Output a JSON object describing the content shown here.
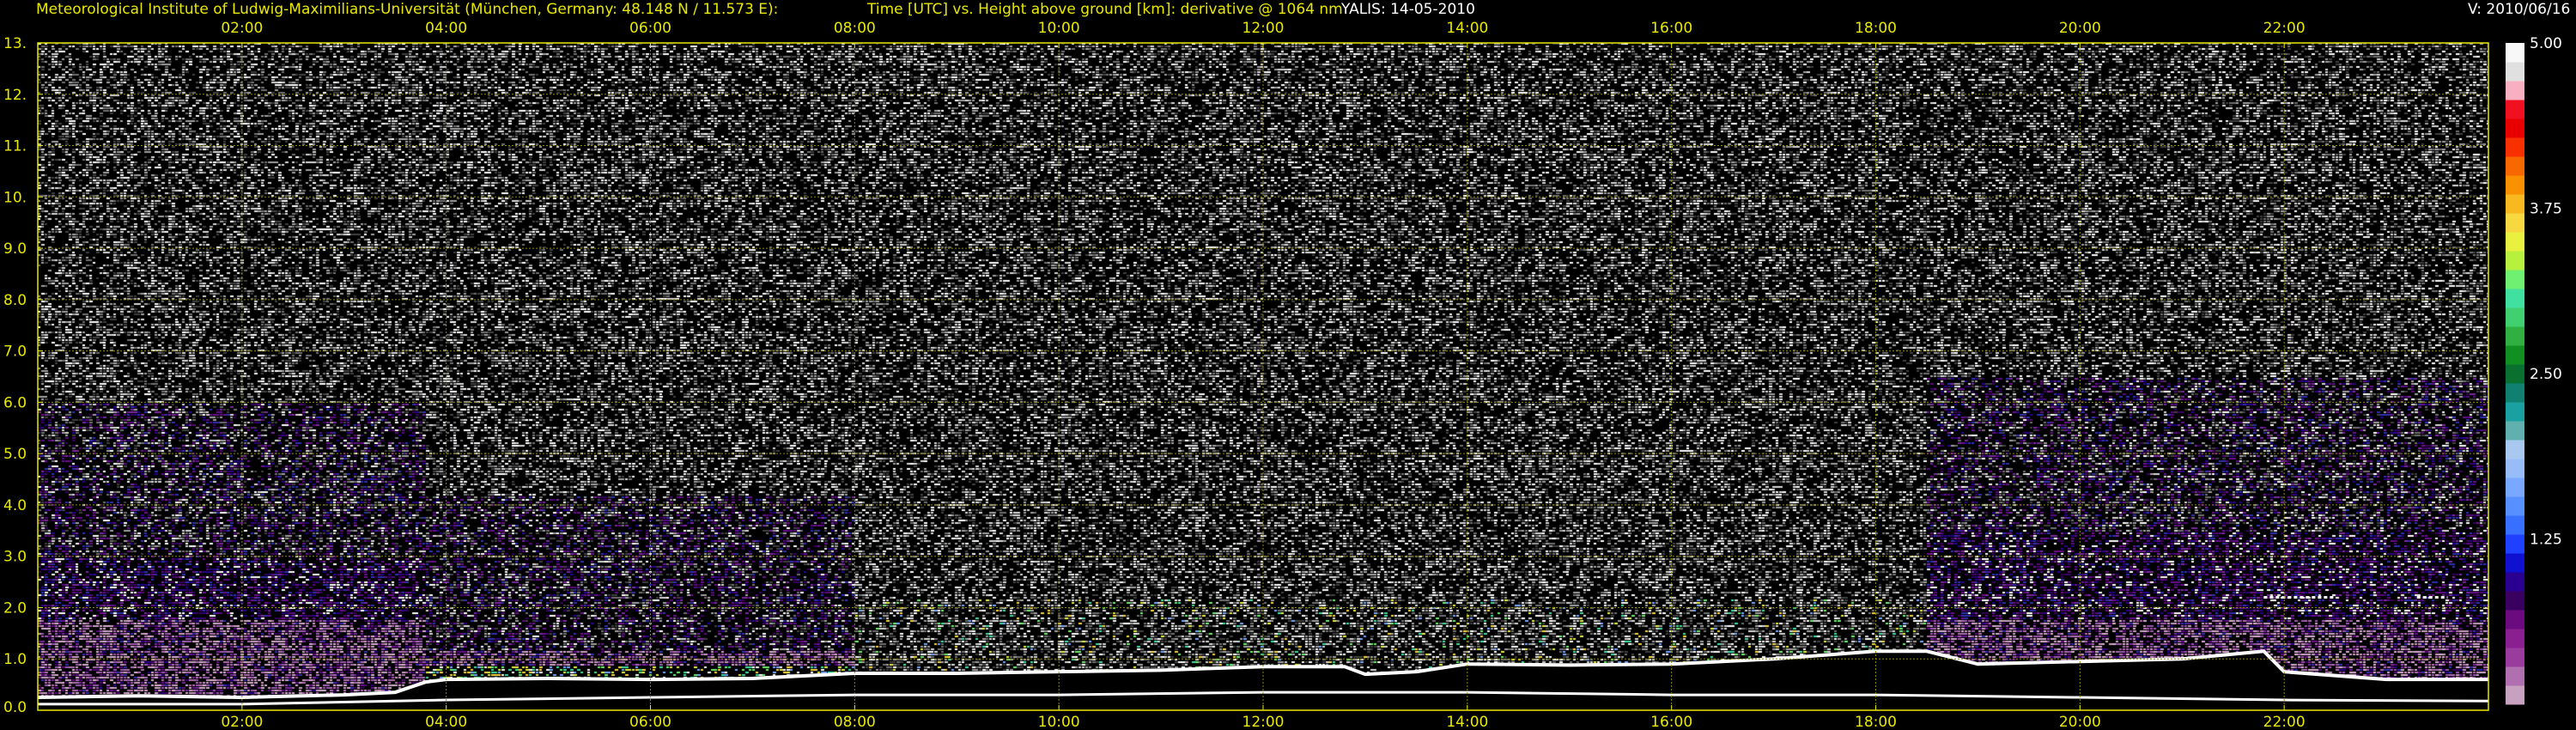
{
  "header": {
    "institute": "Meteorological Institute of Ludwig-Maximilians-Universität (München, Germany: 48.148 N / 11.573 E):",
    "description": "Time [UTC] vs. Height above ground [km]: derivative @ 1064 nm",
    "instrument_date": "YALIS: 14-05-2010",
    "version": "V: 2010/06/16"
  },
  "colors": {
    "axis_text": "#e8e800",
    "grid": "#8a8a00",
    "frame": "#e8e800",
    "background": "#000000"
  },
  "chart_data": {
    "type": "heatmap",
    "title": "Time [UTC] vs. Height above ground [km]: derivative @ 1064 nm",
    "xlabel": "Time [UTC]",
    "ylabel": "Height above ground [km]",
    "xlim": [
      0,
      24
    ],
    "ylim": [
      0,
      13
    ],
    "x_ticks": [
      {
        "hour": 2,
        "label": "02:00"
      },
      {
        "hour": 4,
        "label": "04:00"
      },
      {
        "hour": 6,
        "label": "06:00"
      },
      {
        "hour": 8,
        "label": "08:00"
      },
      {
        "hour": 10,
        "label": "10:00"
      },
      {
        "hour": 12,
        "label": "12:00"
      },
      {
        "hour": 14,
        "label": "14:00"
      },
      {
        "hour": 16,
        "label": "16:00"
      },
      {
        "hour": 18,
        "label": "18:00"
      },
      {
        "hour": 20,
        "label": "20:00"
      },
      {
        "hour": 22,
        "label": "22:00"
      }
    ],
    "y_ticks": [
      {
        "km": 0,
        "label": "0.0"
      },
      {
        "km": 1,
        "label": "1.0"
      },
      {
        "km": 2,
        "label": "2.0"
      },
      {
        "km": 3,
        "label": "3.0"
      },
      {
        "km": 4,
        "label": "4.0"
      },
      {
        "km": 5,
        "label": "5.0"
      },
      {
        "km": 6,
        "label": "6.0"
      },
      {
        "km": 7,
        "label": "7.0"
      },
      {
        "km": 8,
        "label": "8.0"
      },
      {
        "km": 9,
        "label": "9.0"
      },
      {
        "km": 10,
        "label": "10."
      },
      {
        "km": 11,
        "label": "11."
      },
      {
        "km": 12,
        "label": "12."
      },
      {
        "km": 13,
        "label": "13."
      }
    ],
    "grid": true,
    "colorbar": {
      "min": 0,
      "max": 5,
      "ticks": [
        {
          "value": 5.0,
          "label": "5.00"
        },
        {
          "value": 3.75,
          "label": "3.75"
        },
        {
          "value": 2.5,
          "label": "2.50"
        },
        {
          "value": 1.25,
          "label": "1.25"
        }
      ],
      "colors": [
        "#c8a0c0",
        "#b070b0",
        "#9a3c9e",
        "#8a2090",
        "#6a0c80",
        "#3a0060",
        "#2a0090",
        "#1010d0",
        "#2040ff",
        "#3870ff",
        "#5890ff",
        "#78a8ff",
        "#98bcf8",
        "#a8c8f0",
        "#60b0b0",
        "#1aa0a0",
        "#108070",
        "#0a7030",
        "#109020",
        "#30b040",
        "#40d070",
        "#40e0a0",
        "#70f070",
        "#b8f040",
        "#e8f040",
        "#f8d840",
        "#f8b820",
        "#f89000",
        "#f86800",
        "#f83000",
        "#e80000",
        "#f01020",
        "#f8b0c0",
        "#e0e0e0",
        "#f8f8f8"
      ]
    },
    "boundary_layer_top_km": [
      [
        0.0,
        0.25
      ],
      [
        1.0,
        0.28
      ],
      [
        2.0,
        0.25
      ],
      [
        3.0,
        0.3
      ],
      [
        3.5,
        0.35
      ],
      [
        3.8,
        0.55
      ],
      [
        4.0,
        0.6
      ],
      [
        5.0,
        0.62
      ],
      [
        6.0,
        0.6
      ],
      [
        7.0,
        0.62
      ],
      [
        8.0,
        0.72
      ],
      [
        9.0,
        0.72
      ],
      [
        10.0,
        0.75
      ],
      [
        11.0,
        0.78
      ],
      [
        12.0,
        0.85
      ],
      [
        12.8,
        0.85
      ],
      [
        13.0,
        0.7
      ],
      [
        13.5,
        0.75
      ],
      [
        14.0,
        0.9
      ],
      [
        15.0,
        0.88
      ],
      [
        16.0,
        0.9
      ],
      [
        17.0,
        1.0
      ],
      [
        18.0,
        1.15
      ],
      [
        18.5,
        1.15
      ],
      [
        19.0,
        0.9
      ],
      [
        20.0,
        0.95
      ],
      [
        21.0,
        1.0
      ],
      [
        21.8,
        1.15
      ],
      [
        22.0,
        0.75
      ],
      [
        23.0,
        0.6
      ],
      [
        24.0,
        0.6
      ]
    ],
    "surface_layer_km": [
      [
        0.0,
        0.12
      ],
      [
        2.0,
        0.12
      ],
      [
        4.0,
        0.2
      ],
      [
        6.0,
        0.25
      ],
      [
        8.0,
        0.3
      ],
      [
        10.0,
        0.3
      ],
      [
        12.0,
        0.35
      ],
      [
        14.0,
        0.35
      ],
      [
        16.0,
        0.3
      ],
      [
        18.0,
        0.3
      ],
      [
        20.0,
        0.25
      ],
      [
        22.0,
        0.2
      ],
      [
        24.0,
        0.18
      ]
    ],
    "aerosol_layers": [
      {
        "start_hour": 0.0,
        "end_hour": 3.8,
        "bottom_km": 0.3,
        "top_km": 3.0,
        "class": "night-residual"
      },
      {
        "start_hour": 3.8,
        "end_hour": 8.0,
        "bottom_km": 0.6,
        "top_km": 1.2,
        "class": "morning-mixed"
      },
      {
        "start_hour": 18.5,
        "end_hour": 24.0,
        "bottom_km": 0.9,
        "top_km": 3.5,
        "class": "evening-residual"
      }
    ],
    "elevated_layers": [
      {
        "start_hour": 21.8,
        "end_hour": 22.5,
        "height_km": 2.2
      },
      {
        "start_hour": 23.3,
        "end_hour": 23.6,
        "height_km": 2.2
      }
    ]
  }
}
